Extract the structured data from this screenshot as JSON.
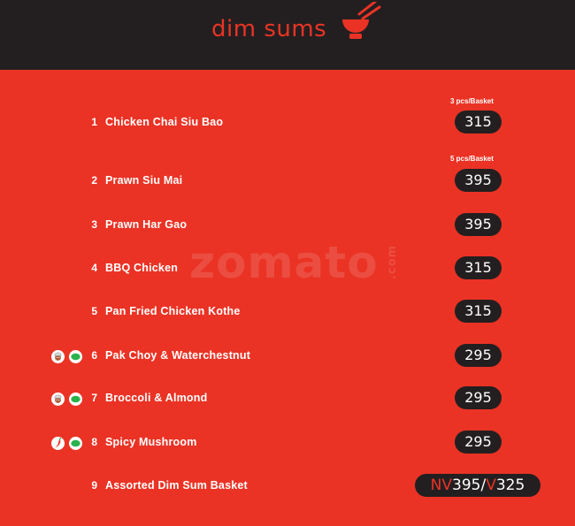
{
  "header": {
    "title": "dim sums",
    "icon": "bowl-chopsticks-icon"
  },
  "watermark": {
    "brand": "zomato",
    "suffix": ".com"
  },
  "colors": {
    "accent": "#ea3325",
    "dark": "#231f20",
    "veg": "#2bb24c"
  },
  "items": [
    {
      "number": "1",
      "name": "Chicken Chai Siu Bao",
      "price": "315",
      "note": "3 pcs/Basket",
      "badges": []
    },
    {
      "number": "2",
      "name": "Prawn Siu Mai",
      "price": "395",
      "note": "5 pcs/Basket",
      "badges": []
    },
    {
      "number": "3",
      "name": "Prawn Har Gao",
      "price": "395",
      "badges": []
    },
    {
      "number": "4",
      "name": "BBQ Chicken",
      "price": "315",
      "badges": []
    },
    {
      "number": "5",
      "name": "Pan Fried Chicken Kothe",
      "price": "315",
      "badges": []
    },
    {
      "number": "6",
      "name": "Pak Choy & Waterchestnut",
      "price": "295",
      "badges": [
        "chef-icon",
        "veg-icon"
      ]
    },
    {
      "number": "7",
      "name": "Broccoli & Almond",
      "price": "295",
      "badges": [
        "chef-icon",
        "veg-icon"
      ]
    },
    {
      "number": "8",
      "name": "Spicy Mushroom",
      "price": "295",
      "badges": [
        "chili-icon",
        "veg-icon"
      ]
    },
    {
      "number": "9",
      "name": "Assorted Dim Sum Basket",
      "price_nv_label": "NV",
      "price_nv": "395",
      "price_sep": "/",
      "price_v_label": "V",
      "price_v": "325",
      "badges": []
    }
  ]
}
